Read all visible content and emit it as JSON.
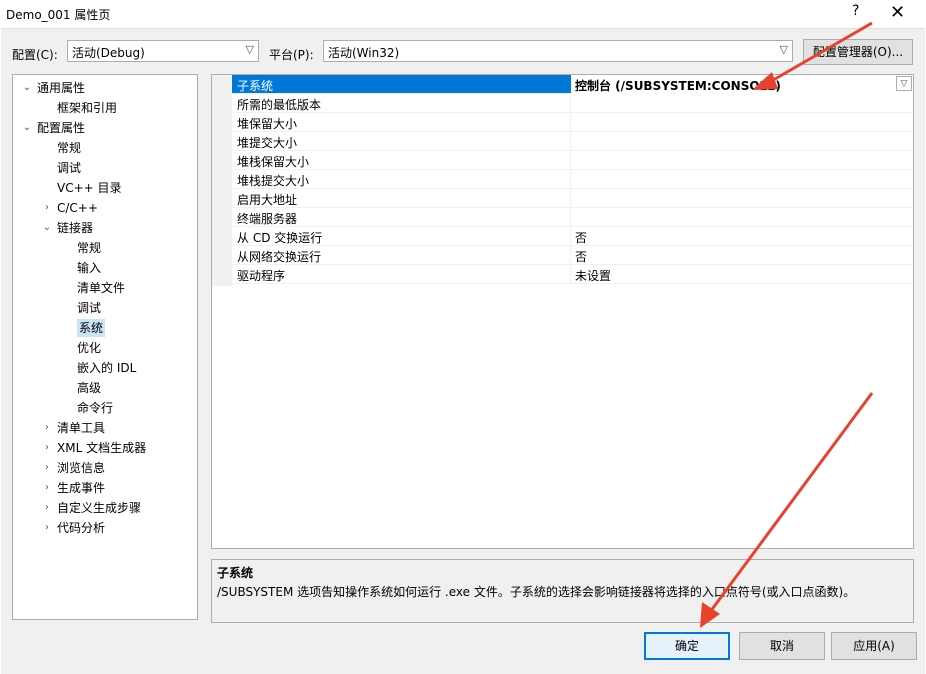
{
  "window": {
    "title": "Demo_001 属性页",
    "help": "?",
    "close": "✕"
  },
  "config": {
    "label": "配置(C):",
    "value": "活动(Debug)"
  },
  "platform": {
    "label": "平台(P):",
    "value": "活动(Win32)"
  },
  "config_manager_label": "配置管理器(O)...",
  "tree": [
    {
      "label": "通用属性",
      "level": 0,
      "exp": "open"
    },
    {
      "label": "框架和引用",
      "level": 1,
      "exp": ""
    },
    {
      "label": "配置属性",
      "level": 0,
      "exp": "open"
    },
    {
      "label": "常规",
      "level": 1,
      "exp": ""
    },
    {
      "label": "调试",
      "level": 1,
      "exp": ""
    },
    {
      "label": "VC++ 目录",
      "level": 1,
      "exp": ""
    },
    {
      "label": "C/C++",
      "level": 1,
      "exp": "closed"
    },
    {
      "label": "链接器",
      "level": 1,
      "exp": "open"
    },
    {
      "label": "常规",
      "level": 2,
      "exp": ""
    },
    {
      "label": "输入",
      "level": 2,
      "exp": ""
    },
    {
      "label": "清单文件",
      "level": 2,
      "exp": ""
    },
    {
      "label": "调试",
      "level": 2,
      "exp": ""
    },
    {
      "label": "系统",
      "level": 2,
      "exp": "",
      "selected": true
    },
    {
      "label": "优化",
      "level": 2,
      "exp": ""
    },
    {
      "label": "嵌入的 IDL",
      "level": 2,
      "exp": ""
    },
    {
      "label": "高级",
      "level": 2,
      "exp": ""
    },
    {
      "label": "命令行",
      "level": 2,
      "exp": ""
    },
    {
      "label": "清单工具",
      "level": 1,
      "exp": "closed"
    },
    {
      "label": "XML 文档生成器",
      "level": 1,
      "exp": "closed"
    },
    {
      "label": "浏览信息",
      "level": 1,
      "exp": "closed"
    },
    {
      "label": "生成事件",
      "level": 1,
      "exp": "closed"
    },
    {
      "label": "自定义生成步骤",
      "level": 1,
      "exp": "closed"
    },
    {
      "label": "代码分析",
      "level": 1,
      "exp": "closed"
    }
  ],
  "properties": [
    {
      "name": "子系统",
      "value": "控制台 (/SUBSYSTEM:CONSOLE)",
      "selected": true
    },
    {
      "name": "所需的最低版本",
      "value": ""
    },
    {
      "name": "堆保留大小",
      "value": ""
    },
    {
      "name": "堆提交大小",
      "value": ""
    },
    {
      "name": "堆栈保留大小",
      "value": ""
    },
    {
      "name": "堆栈提交大小",
      "value": ""
    },
    {
      "name": "启用大地址",
      "value": ""
    },
    {
      "name": "终端服务器",
      "value": ""
    },
    {
      "name": "从 CD 交换运行",
      "value": "否"
    },
    {
      "name": "从网络交换运行",
      "value": "否"
    },
    {
      "name": "驱动程序",
      "value": "未设置"
    }
  ],
  "description": {
    "title": "子系统",
    "text": "/SUBSYSTEM 选项告知操作系统如何运行 .exe 文件。子系统的选择会影响链接器将选择的入口点符号(或入口点函数)。"
  },
  "buttons": {
    "ok": "确定",
    "cancel": "取消",
    "apply": "应用(A)"
  },
  "icons": {
    "dropdown": "chevron-down-icon",
    "expand": "chevron-right-icon",
    "collapse": "chevron-down-icon"
  },
  "colors": {
    "selection": "#0078d7",
    "annotation": "#e8412c"
  }
}
